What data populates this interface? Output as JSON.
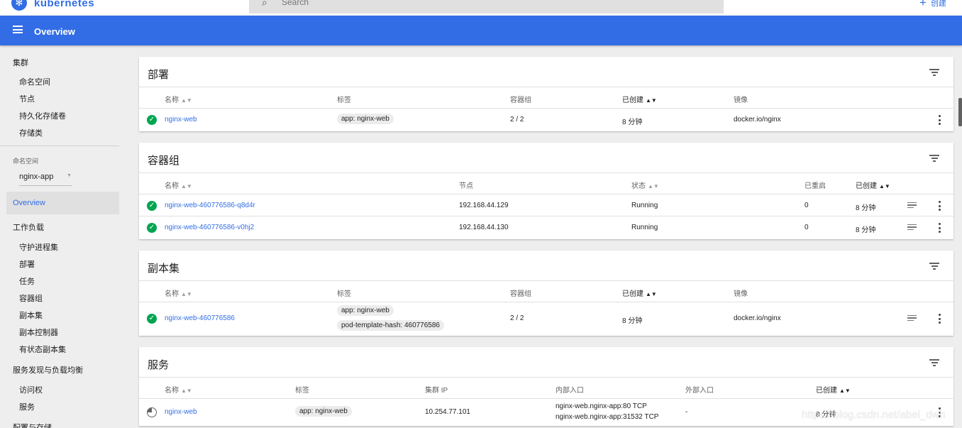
{
  "brand": {
    "name": "kubernetes",
    "logo_icon": "helm-wheel-icon",
    "color": "#326de6"
  },
  "search": {
    "placeholder": "Search"
  },
  "top_actions": {
    "create_label": "创建"
  },
  "header": {
    "title": "Overview"
  },
  "sidebar": {
    "cluster_label": "集群",
    "cluster_items": [
      "命名空间",
      "节点",
      "持久化存储卷",
      "存储类"
    ],
    "namespace_label": "命名空间",
    "namespace_value": "nginx-app",
    "overview_label": "Overview",
    "workloads_label": "工作负载",
    "workload_items": [
      "守护进程集",
      "部署",
      "任务",
      "容器组",
      "副本集",
      "副本控制器",
      "有状态副本集"
    ],
    "discovery_label": "服务发现与负载均衡",
    "discovery_items": [
      "访问权",
      "服务"
    ],
    "config_label": "配置与存储"
  },
  "deployments": {
    "title": "部署",
    "columns": [
      "名称",
      "标签",
      "容器组",
      "已创建",
      "镜像"
    ],
    "rows": [
      {
        "name": "nginx-web",
        "label": "app: nginx-web",
        "pods": "2 / 2",
        "created": "8 分钟",
        "image": "docker.io/nginx"
      }
    ]
  },
  "pods": {
    "title": "容器组",
    "columns": [
      "名称",
      "节点",
      "状态",
      "已重启",
      "已创建"
    ],
    "rows": [
      {
        "name": "nginx-web-460776586-q8d4r",
        "node": "192.168.44.129",
        "status": "Running",
        "restarts": "0",
        "created": "8 分钟"
      },
      {
        "name": "nginx-web-460776586-v0hj2",
        "node": "192.168.44.130",
        "status": "Running",
        "restarts": "0",
        "created": "8 分钟"
      }
    ]
  },
  "replicasets": {
    "title": "副本集",
    "columns": [
      "名称",
      "标签",
      "容器组",
      "已创建",
      "镜像"
    ],
    "rows": [
      {
        "name": "nginx-web-460776586",
        "labels": [
          "app: nginx-web",
          "pod-template-hash: 460776586"
        ],
        "pods": "2 / 2",
        "created": "8 分钟",
        "image": "docker.io/nginx"
      }
    ]
  },
  "services": {
    "title": "服务",
    "columns": [
      "名称",
      "标签",
      "集群 IP",
      "内部入口",
      "外部入口",
      "已创建"
    ],
    "rows": [
      {
        "name": "nginx-web",
        "label": "app: nginx-web",
        "cluster_ip": "10.254.77.101",
        "internal": [
          "nginx-web.nginx-app:80 TCP",
          "nginx-web.nginx-app:31532 TCP"
        ],
        "external": "-",
        "created": "8 分钟"
      }
    ]
  },
  "watermark": "https://blog.csdn.net/abel_dwh",
  "colors": {
    "primary": "#326de6",
    "success": "#00a550",
    "background": "#eeeeee"
  }
}
